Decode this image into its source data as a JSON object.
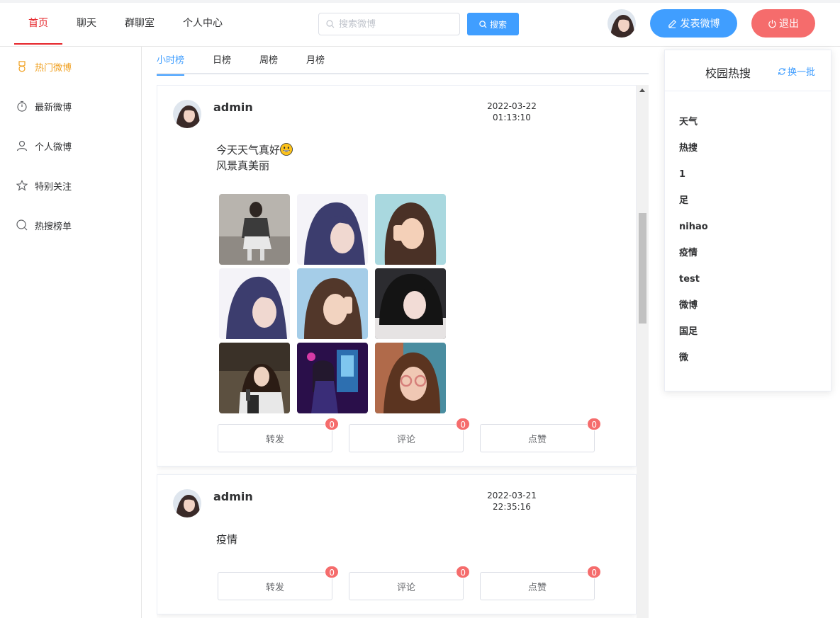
{
  "nav": {
    "items": [
      {
        "label": "首页"
      },
      {
        "label": "聊天"
      },
      {
        "label": "群聊室"
      },
      {
        "label": "个人中心"
      }
    ]
  },
  "search": {
    "placeholder": "搜索微博",
    "button_label": "搜索"
  },
  "header": {
    "post_label": "发表微博",
    "logout_label": "退出"
  },
  "sidebar": {
    "items": [
      {
        "label": "热门微博",
        "icon": "medal-icon"
      },
      {
        "label": "最新微博",
        "icon": "stopwatch-icon"
      },
      {
        "label": "个人微博",
        "icon": "user-icon"
      },
      {
        "label": "特别关注",
        "icon": "star-icon"
      },
      {
        "label": "热搜榜单",
        "icon": "search-icon"
      }
    ]
  },
  "tabs": [
    {
      "label": "小时榜"
    },
    {
      "label": "日榜"
    },
    {
      "label": "周榜"
    },
    {
      "label": "月榜"
    }
  ],
  "posts": [
    {
      "user": "admin",
      "date": "2022-03-22",
      "time": "01:13:10",
      "text_line1": "今天天气真好",
      "text_line2": "风景真美丽",
      "image_count": 9,
      "actions": {
        "repost_label": "转发",
        "repost_count": "0",
        "comment_label": "评论",
        "comment_count": "0",
        "like_label": "点赞",
        "like_count": "0"
      }
    },
    {
      "user": "admin",
      "date": "2022-03-21",
      "time": "22:35:16",
      "text_line1": "疫情",
      "actions": {
        "repost_label": "转发",
        "repost_count": "0",
        "comment_label": "评论",
        "comment_count": "0",
        "like_label": "点赞",
        "like_count": "0"
      }
    }
  ],
  "hot_search": {
    "title": "校园热搜",
    "refresh_label": "换一批",
    "items": [
      "天气",
      "热搜",
      "1",
      "足",
      "nihao",
      "疫情",
      "test",
      "微博",
      "国足",
      "微"
    ]
  },
  "colors": {
    "primary": "#409eff",
    "danger": "#f56c6c",
    "nav_active": "#e6252a",
    "sidebar_active": "#f0a020"
  }
}
